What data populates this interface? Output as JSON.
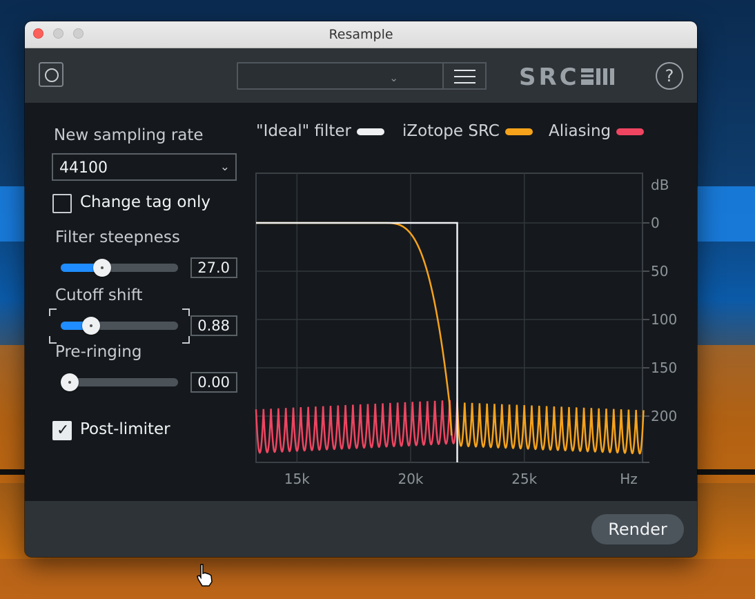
{
  "window": {
    "title": "Resample"
  },
  "toolbar": {
    "logo_text": "SRC",
    "help_label": "?"
  },
  "controls": {
    "sampling_rate_label": "New sampling rate",
    "sampling_rate_value": "44100",
    "change_tag_label": "Change tag only",
    "change_tag_checked": false,
    "filter_steepness_label": "Filter steepness",
    "filter_steepness_value": "27.0",
    "filter_steepness_fraction": 0.35,
    "cutoff_shift_label": "Cutoff shift",
    "cutoff_shift_value": "0.88",
    "cutoff_shift_fraction": 0.26,
    "pre_ringing_label": "Pre-ringing",
    "pre_ringing_value": "0.00",
    "pre_ringing_fraction": 0.0,
    "post_limiter_label": "Post-limiter",
    "post_limiter_checked": true
  },
  "footer": {
    "render_label": "Render"
  },
  "colors": {
    "ideal": "#eef0f2",
    "src": "#f7a21b",
    "aliasing": "#ef4561",
    "accent": "#1f8cff"
  },
  "chart_data": {
    "type": "line",
    "legend": [
      {
        "name": "\"Ideal\" filter",
        "color": "#eef0f2"
      },
      {
        "name": "iZotope SRC",
        "color": "#f7a21b"
      },
      {
        "name": "Aliasing",
        "color": "#ef4561"
      }
    ],
    "x_unit": "Hz",
    "y_unit": "dB",
    "x_ticks": [
      {
        "value": 15000,
        "label": "15k"
      },
      {
        "value": 20000,
        "label": "20k"
      },
      {
        "value": 25000,
        "label": "25k"
      }
    ],
    "y_ticks": [
      {
        "value": 0,
        "label": "0"
      },
      {
        "value": -50,
        "label": "50"
      },
      {
        "value": -100,
        "label": "100"
      },
      {
        "value": -150,
        "label": "150"
      },
      {
        "value": -200,
        "label": "200"
      }
    ],
    "xlim": [
      13200,
      30200
    ],
    "ylim": [
      -250,
      50
    ],
    "grid": true,
    "series": [
      {
        "name": "\"Ideal\" filter",
        "cutoff_hz": 22050,
        "passband_db": 0
      },
      {
        "name": "iZotope SRC",
        "passband_db": 0,
        "rolloff_start_hz": 18800,
        "stopband_db": -185
      },
      {
        "name": "Aliasing",
        "from_hz": 13200,
        "to_hz": 22050,
        "level_db": -193
      }
    ]
  }
}
